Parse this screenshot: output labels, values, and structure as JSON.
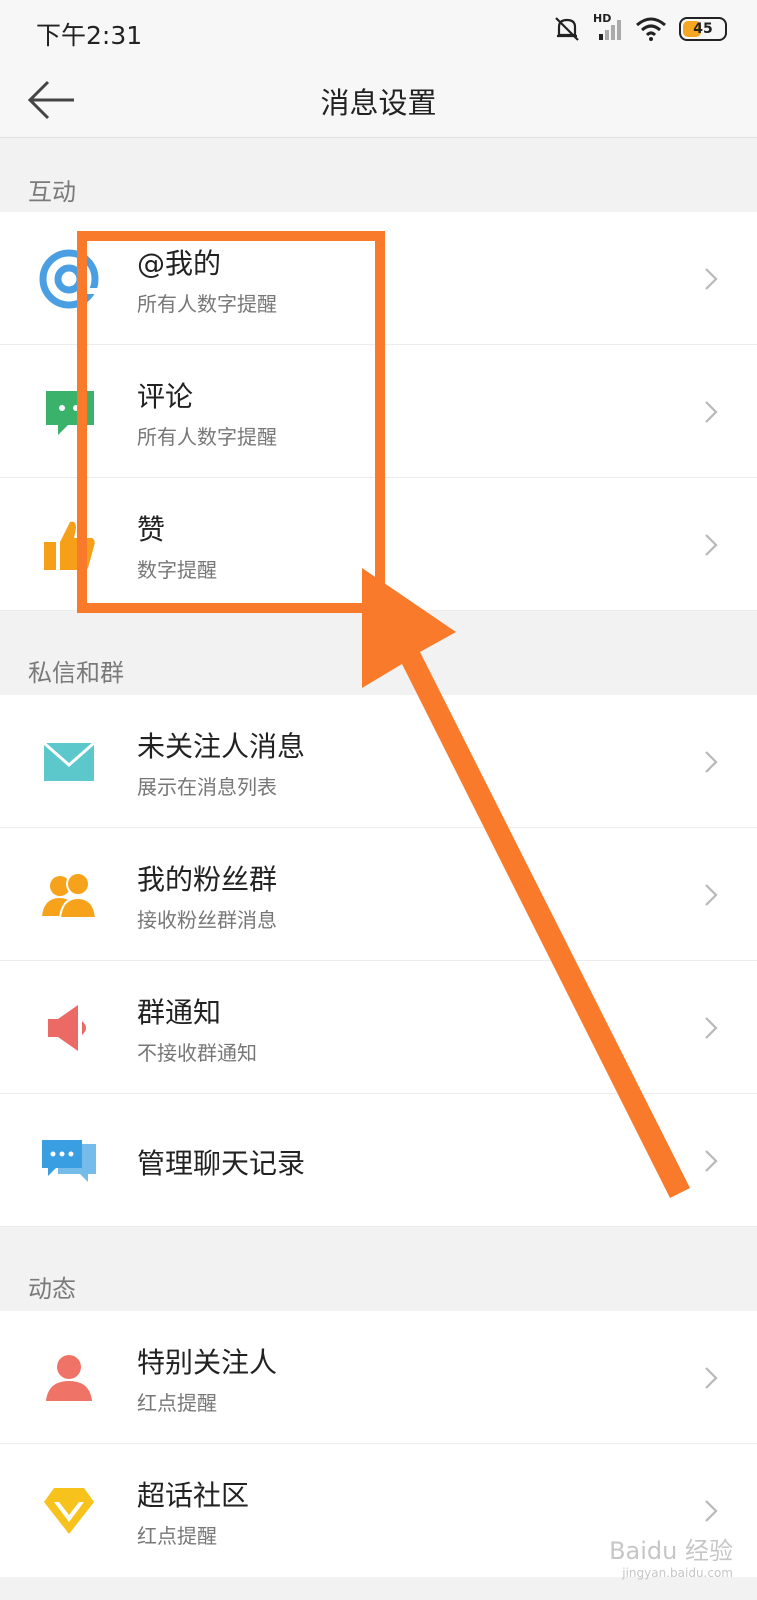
{
  "status_bar": {
    "time": "下午2:31",
    "network": "HD",
    "battery": "45",
    "battery_level": 0.45
  },
  "header": {
    "title": "消息设置",
    "back_icon": "back-arrow-icon"
  },
  "sections": [
    {
      "title": "互动",
      "items": [
        {
          "label": "@我的",
          "sublabel": "所有人数字提醒",
          "icon": "at-icon",
          "color": "#4a9fe3"
        },
        {
          "label": "评论",
          "sublabel": "所有人数字提醒",
          "icon": "comment-icon",
          "color": "#3ab26b"
        },
        {
          "label": "赞",
          "sublabel": "数字提醒",
          "icon": "thumbs-up-icon",
          "color": "#f6a01a"
        }
      ]
    },
    {
      "title": "私信和群",
      "items": [
        {
          "label": "未关注人消息",
          "sublabel": "展示在消息列表",
          "icon": "mail-icon",
          "color": "#5cc8cc"
        },
        {
          "label": "我的粉丝群",
          "sublabel": "接收粉丝群消息",
          "icon": "fans-group-icon",
          "color": "#f7a21b"
        },
        {
          "label": "群通知",
          "sublabel": "不接收群通知",
          "icon": "megaphone-icon",
          "color": "#ec6a66"
        },
        {
          "label": "管理聊天记录",
          "sublabel": "",
          "icon": "chat-bubbles-icon",
          "color": "#3a9fe2"
        }
      ]
    },
    {
      "title": "动态",
      "items": [
        {
          "label": "特别关注人",
          "sublabel": "红点提醒",
          "icon": "person-icon",
          "color": "#ef7366"
        },
        {
          "label": "超话社区",
          "sublabel": "红点提醒",
          "icon": "diamond-icon",
          "color": "#f7c21c"
        }
      ]
    }
  ],
  "annotation": {
    "color": "#fa7a2c"
  },
  "watermark": {
    "text": "Baidu 经验",
    "url": "jingyan.baidu.com"
  }
}
